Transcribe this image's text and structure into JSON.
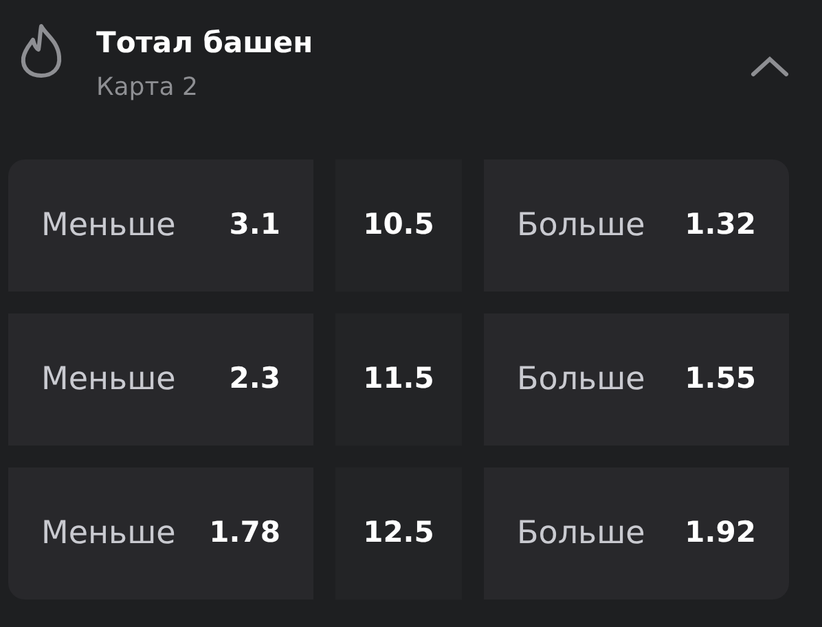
{
  "header": {
    "title": "Тотал башен",
    "subtitle": "Карта 2",
    "expanded": true
  },
  "rows": [
    {
      "under": {
        "label": "Меньше",
        "odds": "3.1"
      },
      "line": "10.5",
      "over": {
        "label": "Больше",
        "odds": "1.32"
      }
    },
    {
      "under": {
        "label": "Меньше",
        "odds": "2.3"
      },
      "line": "11.5",
      "over": {
        "label": "Больше",
        "odds": "1.55"
      }
    },
    {
      "under": {
        "label": "Меньше",
        "odds": "1.78"
      },
      "line": "12.5",
      "over": {
        "label": "Больше",
        "odds": "1.92"
      }
    }
  ]
}
